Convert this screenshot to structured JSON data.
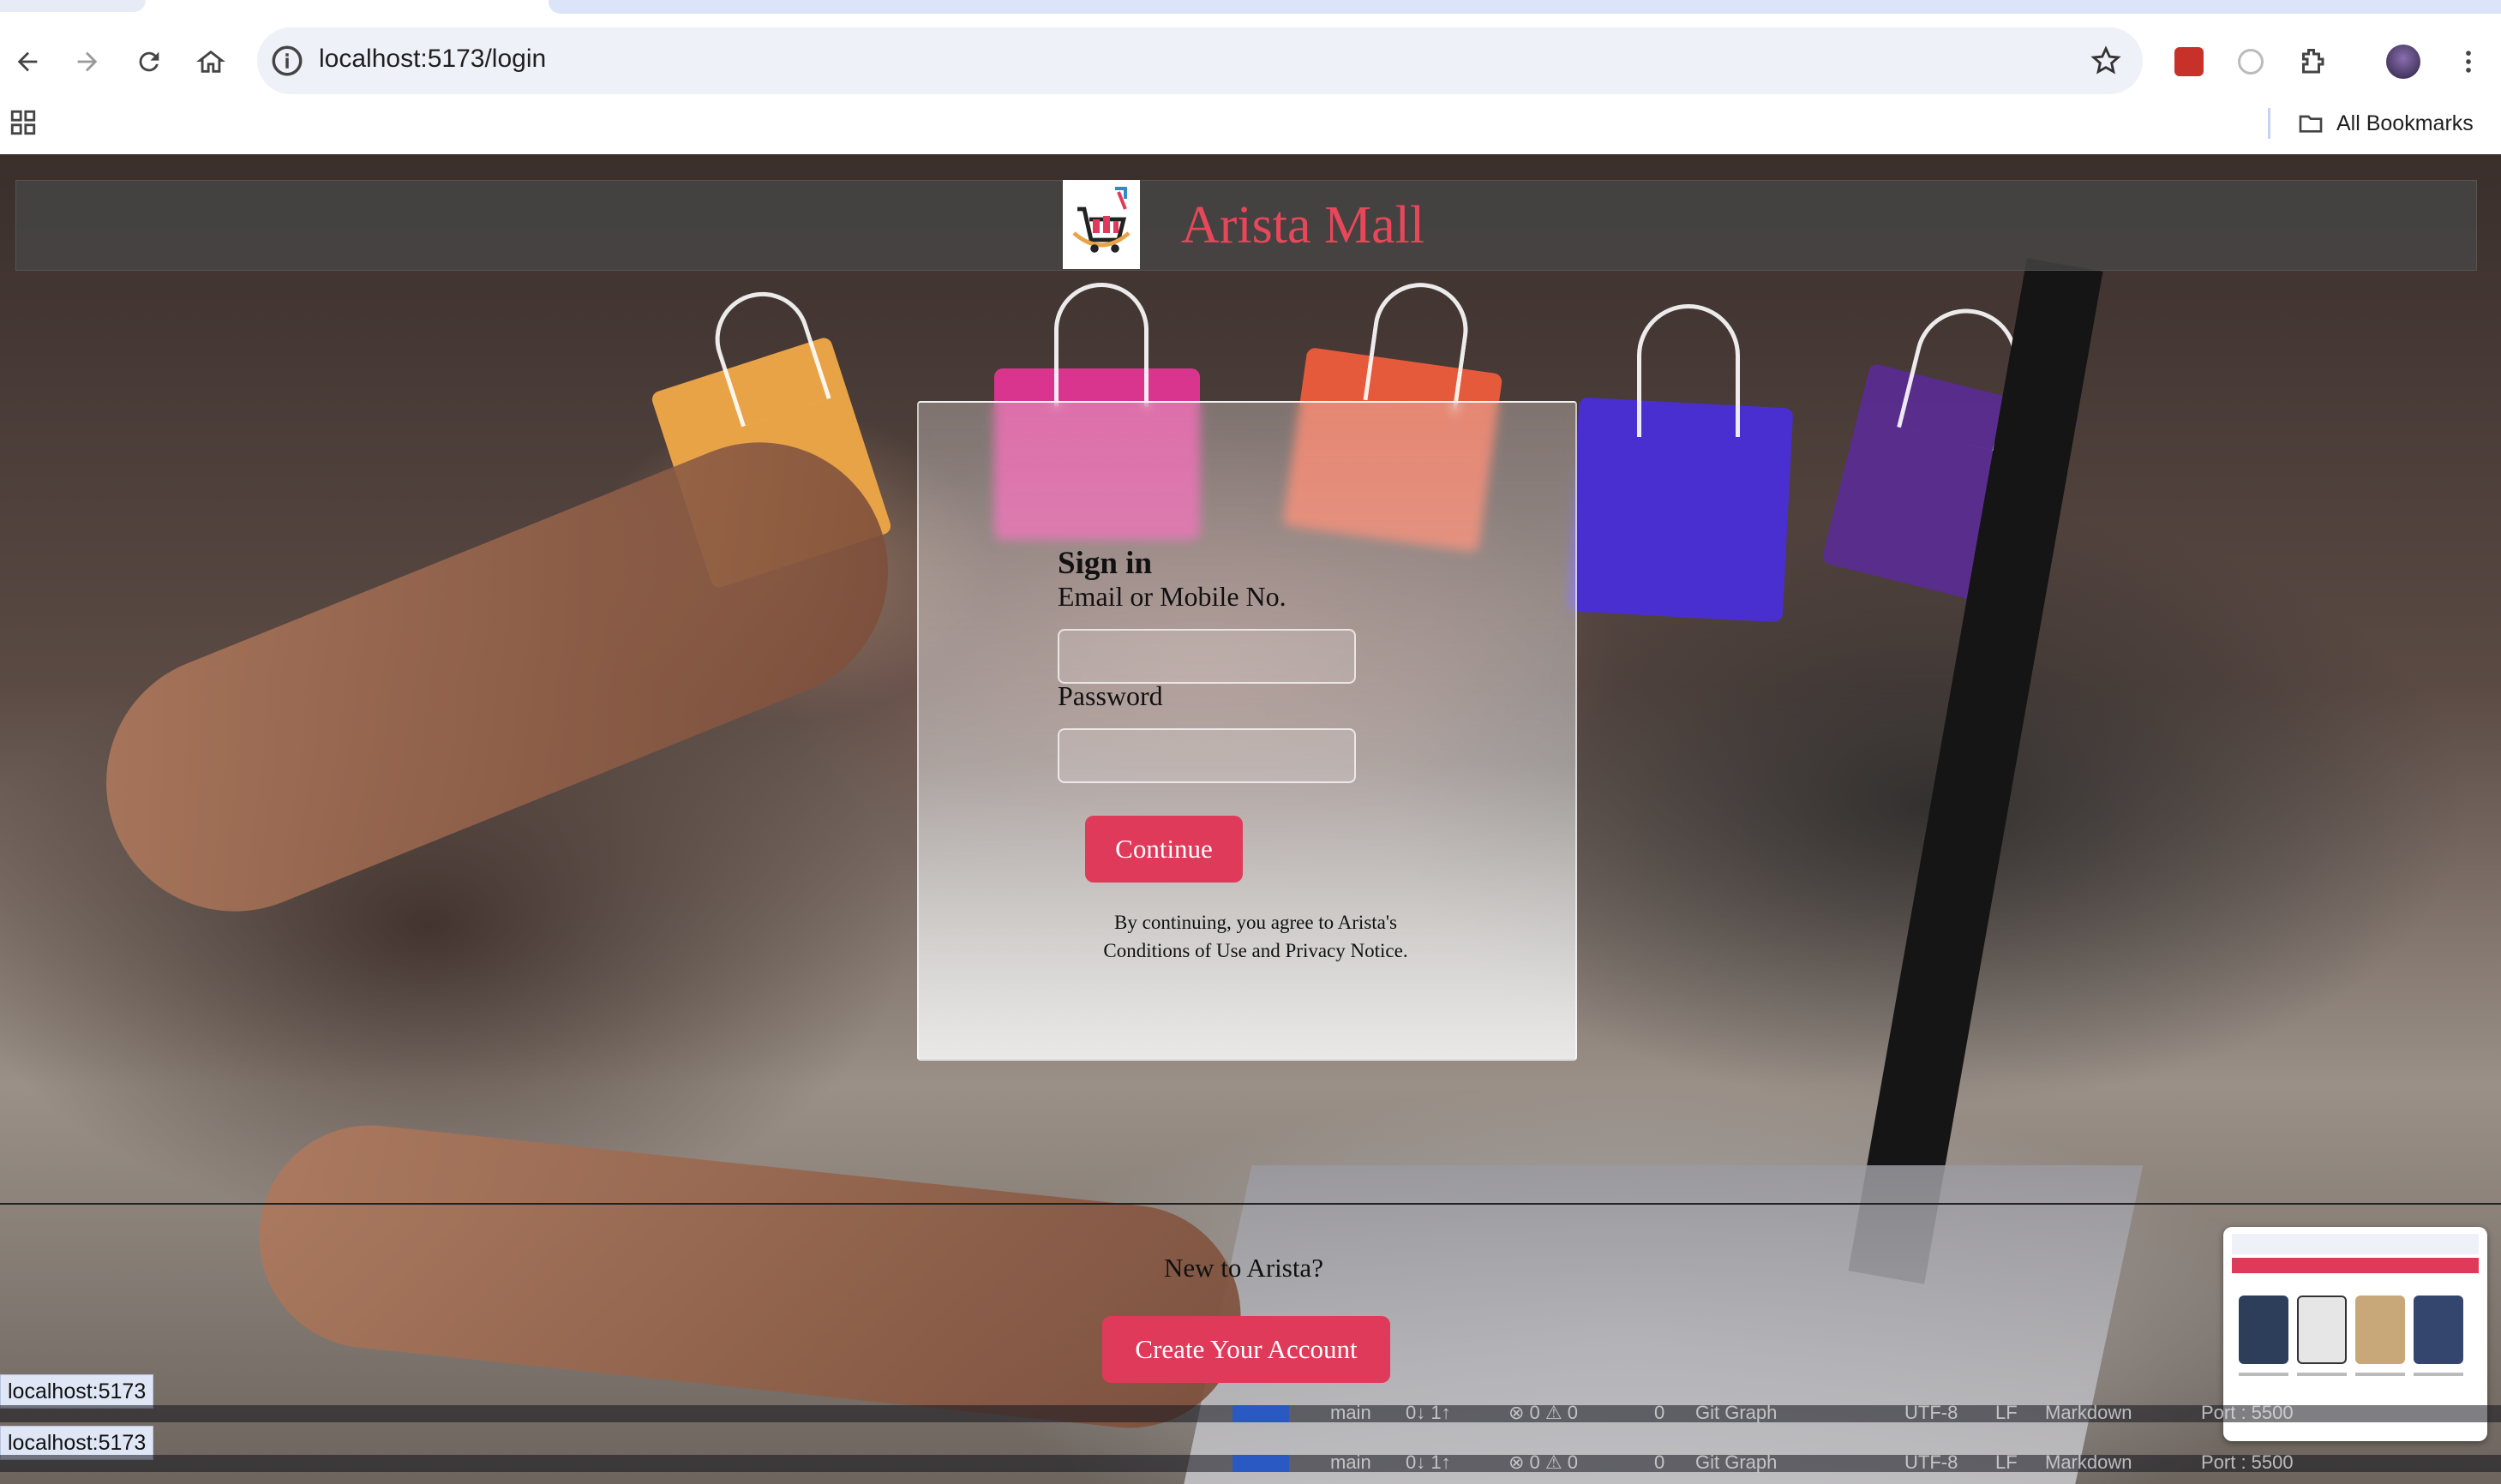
{
  "browser": {
    "url": "localhost:5173/login",
    "bookmarks_label": "All Bookmarks"
  },
  "app": {
    "brand": "Arista Mall",
    "signin": {
      "title": "Sign in",
      "email_label": "Email or Mobile No.",
      "password_label": "Password",
      "continue_label": "Continue",
      "terms_line1": "By continuing, you agree to Arista's",
      "terms_line2": "Conditions of Use and Privacy Notice."
    },
    "new_prompt": "New to Arista?",
    "create_label": "Create Your Account"
  },
  "status_url": "localhost:5173",
  "vscode_status": {
    "branch": "main",
    "sync": "0↓ 1↑",
    "problems": "⊗ 0 ⚠ 0",
    "ports_count": "0",
    "git_graph": "Git Graph",
    "encoding": "UTF-8",
    "eol": "LF",
    "language": "Markdown",
    "port": "Port : 5500"
  },
  "colors": {
    "accent": "#e03a5a",
    "brand_text": "#e8475a"
  }
}
